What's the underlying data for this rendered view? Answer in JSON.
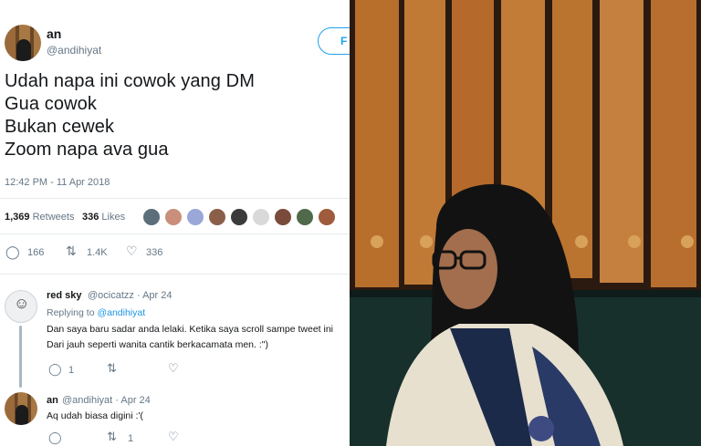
{
  "tweet": {
    "name": "an",
    "handle": "@andihiyat",
    "follow_label": "F",
    "lines": [
      "Udah napa ini cowok yang DM",
      "Gua cowok",
      "Bukan cewek",
      "Zoom napa ava gua"
    ],
    "timestamp": "12:42 PM - 11 Apr 2018",
    "retweets_count": "1,369",
    "retweets_label": "Retweets",
    "likes_count": "336",
    "likes_label": "Likes",
    "reply_count": "166",
    "retweet_action_count": "1.4K",
    "like_action_count": "336"
  },
  "replies": [
    {
      "name": "red sky",
      "handle": "@ocicatzz · Apr 24",
      "replying_prefix": "Replying to",
      "replying_to": "@andihiyat",
      "text_lines": [
        "Dan saya baru sadar anda lelaki. Ketika saya scroll sampe tweet ini",
        "Dari jauh seperti wanita cantik berkacamata men. :\")"
      ],
      "reply_count": "1",
      "retweet_count": "",
      "like_count": ""
    },
    {
      "name": "an",
      "handle": "@andihiyat · Apr 24",
      "text_lines": [
        "Aq udah biasa digini :'("
      ],
      "reply_count": "",
      "retweet_count": "1",
      "like_count": ""
    }
  ],
  "icons": {
    "reply": "reply-icon",
    "retweet": "retweet-icon",
    "like": "heart-icon"
  },
  "colors": {
    "twitter_blue": "#1da1f2",
    "muted": "#657786"
  }
}
